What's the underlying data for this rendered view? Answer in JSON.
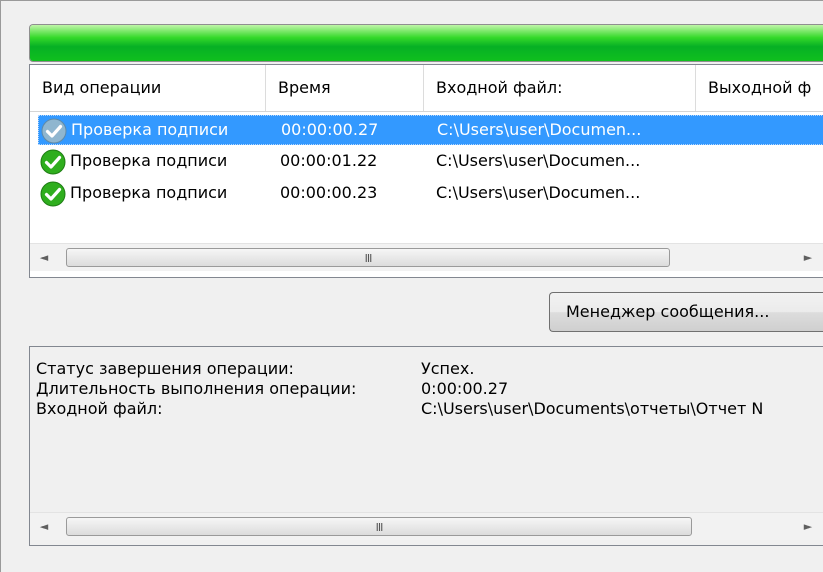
{
  "progress": {
    "value_percent": 100,
    "color": "#06b025"
  },
  "list": {
    "columns": [
      "Вид операции",
      "Время",
      "Входной файл:",
      "Выходной ф"
    ],
    "rows": [
      {
        "operation": "Проверка подписи",
        "time": "00:00:00.27",
        "input": "C:\\Users\\user\\Documen...",
        "selected": true,
        "icon": "check-icon"
      },
      {
        "operation": "Проверка подписи",
        "time": "00:00:01.22",
        "input": "C:\\Users\\user\\Documen...",
        "selected": false,
        "icon": "check-icon"
      },
      {
        "operation": "Проверка подписи",
        "time": "00:00:00.23",
        "input": "C:\\Users\\user\\Documen...",
        "selected": false,
        "icon": "check-icon"
      }
    ],
    "scroll": {
      "left": "◄",
      "right": "►",
      "grip": "III"
    }
  },
  "message_manager_button": "Менеджер сообщения...",
  "details": {
    "status_label": "Статус завершения операции:",
    "status_value": "Успех.",
    "duration_label": "Длительность выполнения операции:",
    "duration_value": "0:00:00.27",
    "input_label": "Входной файл:",
    "input_value": "C:\\Users\\user\\Documents\\отчеты\\Отчет N",
    "scroll": {
      "left": "◄",
      "right": "►",
      "grip": "III"
    }
  },
  "colors": {
    "selection": "#3399ff",
    "accent_green": "#06b025"
  }
}
